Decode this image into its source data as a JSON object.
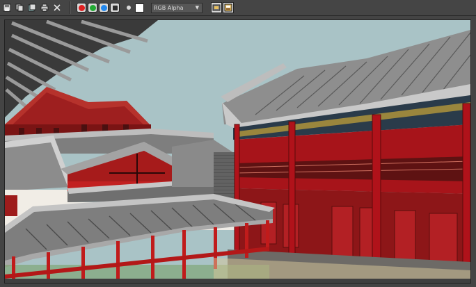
{
  "toolbar": {
    "icons": [
      "save-icon",
      "clone-icon",
      "copy-icon",
      "print-icon",
      "close-icon"
    ],
    "channels": [
      {
        "name": "red-channel",
        "color": "#e02020"
      },
      {
        "name": "green-channel",
        "color": "#22aa33"
      },
      {
        "name": "blue-channel",
        "color": "#2288ee"
      },
      {
        "name": "mono-channel",
        "color": "#2e2e2e"
      }
    ],
    "channel_display": "RGB Alpha",
    "swatch_color": "#ffffff"
  },
  "viewport": {
    "sky_color": "#a9c3c6",
    "roof_color": "#8e8e8e",
    "pillar_color": "#b0121a",
    "ground_color": "#6d6a66"
  }
}
